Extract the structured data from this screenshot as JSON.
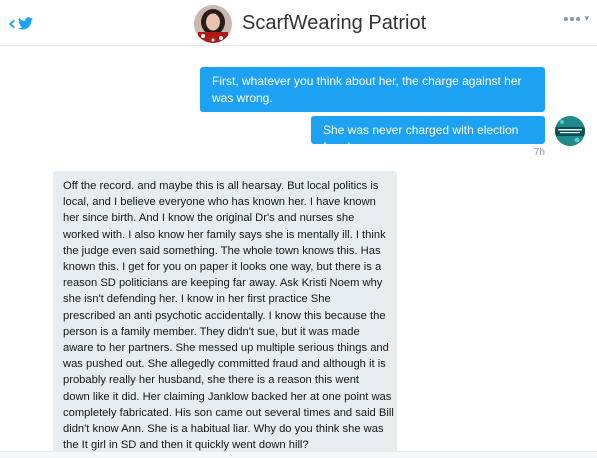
{
  "header": {
    "title": "ScarfWearing Patriot",
    "back_icon": "chevron-left-icon",
    "logo_icon": "twitter-bird-icon",
    "more_icon": "more-options-icon",
    "accent_color": "#1da1f2"
  },
  "messages": {
    "outgoing": [
      "First, whatever you think about her, the charge against her was wrong.",
      "She was never charged with election fraud"
    ],
    "outgoing_time": "7h",
    "incoming_lines": [
      "Off the record. and maybe this is all hearsay. But local politics is",
      "local, and I believe everyone who has known her. I have known",
      "her since birth. And I know the original Dr's and nurses she",
      "worked with. I also know her family says she is mentally ill. I think",
      "the judge even said something. The whole town knows this. Has",
      "known this. I get for you  on paper it looks one way, but there is a",
      "reason SD politicians are keeping far away. Ask Kristi Noem why",
      "she isn't defending her.  I know in her first practice She",
      "prescribed an anti psychotic accidentally. I know this because the",
      "person is a family member. They didn't sue, but it was made",
      "aware to her partners. She messed up multiple serious things and",
      "was pushed out. She allegedly committed fraud and although it is",
      "probably really her husband, she there is a reason this went",
      "down like it did. Her claiming Janklow backed her at one point was",
      "completely fabricated. His son came out several times and said Bill",
      "didn't know Ann. She is a habitual liar. Why do you think she was",
      "the It girl in SD and then it quickly went down hill?"
    ]
  },
  "colors": {
    "outgoing_bubble": "#1da1f2",
    "incoming_bubble": "#e6ecf0"
  }
}
